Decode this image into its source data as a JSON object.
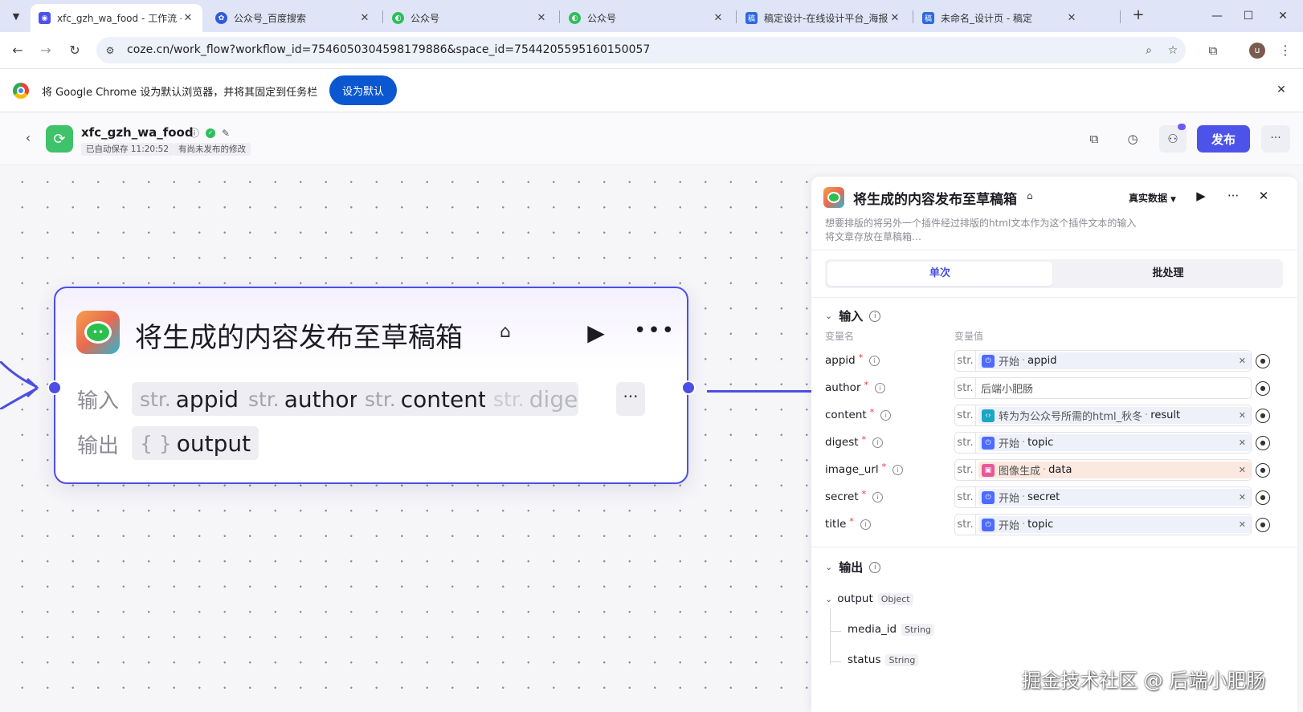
{
  "browser": {
    "tabs": [
      {
        "title": "xfc_gzh_wa_food - 工作流 - 扣子",
        "active": true
      },
      {
        "title": "公众号_百度搜索",
        "active": false
      },
      {
        "title": "公众号",
        "active": false
      },
      {
        "title": "公众号",
        "active": false
      },
      {
        "title": "稿定设计-在线设计平台_海报",
        "active": false
      },
      {
        "title": "未命名_设计页 - 稿定",
        "active": false
      }
    ],
    "url": "coze.cn/work_flow?workflow_id=7546050304598179886&space_id=7544205595160150057",
    "infobar": {
      "message": "将 Google Chrome 设为默认浏览器，并将其固定到任务栏",
      "button": "设为默认"
    },
    "avatar_letter": "u"
  },
  "header": {
    "workflow_name": "xfc_gzh_wa_food",
    "autosave": "已自动保存 11:20:52",
    "unpublished": "有尚未发布的修改",
    "publish_label": "发布"
  },
  "node": {
    "title": "将生成的内容发布至草稿箱",
    "input_label": "输入",
    "output_label": "输出",
    "inputs": [
      {
        "type": "str.",
        "name": "appid"
      },
      {
        "type": "str.",
        "name": "author"
      },
      {
        "type": "str.",
        "name": "content"
      },
      {
        "type": "str.",
        "name": "diges"
      }
    ],
    "output": {
      "type": "{ }",
      "name": "output"
    }
  },
  "panel": {
    "title": "将生成的内容发布至草稿箱",
    "mode": "真实数据",
    "description_1": "想要排版的将另外一个插件经过排版的html文本作为这个插件文本的输入",
    "description_2": "将文章存放在草稿箱…",
    "tabs": {
      "single": "单次",
      "batch": "批处理"
    },
    "input_section": "输入",
    "col_name": "变量名",
    "col_value": "变量值",
    "inputs": [
      {
        "name": "appid",
        "type": "str.",
        "ref_node": "开始",
        "ref_field": "appid"
      },
      {
        "name": "author",
        "type": "str.",
        "literal": "后端小肥肠"
      },
      {
        "name": "content",
        "type": "str.",
        "ref_node": "转为为公众号所需的html_秋冬",
        "ref_field": "result"
      },
      {
        "name": "digest",
        "type": "str.",
        "ref_node": "开始",
        "ref_field": "topic"
      },
      {
        "name": "image_url",
        "type": "str.",
        "ref_node": "图像生成",
        "ref_field": "data"
      },
      {
        "name": "secret",
        "type": "str.",
        "ref_node": "开始",
        "ref_field": "secret"
      },
      {
        "name": "title",
        "type": "str.",
        "ref_node": "开始",
        "ref_field": "topic"
      }
    ],
    "output_section": "输出",
    "outputs": {
      "root": {
        "name": "output",
        "type": "Object"
      },
      "children": [
        {
          "name": "media_id",
          "type": "String"
        },
        {
          "name": "status",
          "type": "String"
        }
      ]
    }
  },
  "watermark": "掘金技术社区 @ 后端小肥肠",
  "colors": {
    "accent": "#4d53e8",
    "node_border": "#4c4fe3",
    "plugin_green": "#2bc04d",
    "start_ref": "#4d6bfe",
    "code_ref": "#1aa7c4",
    "image_ref": "#e8579a"
  }
}
